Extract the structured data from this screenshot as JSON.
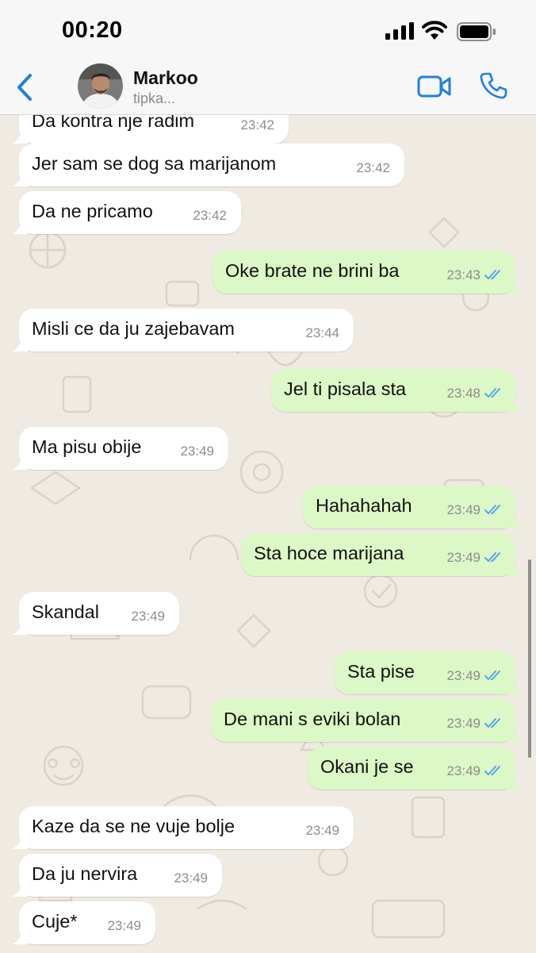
{
  "status_bar": {
    "time": "00:20"
  },
  "header": {
    "contact_name": "Markoo",
    "contact_status": "tipka..."
  },
  "messages": [
    {
      "text": "Da kontra nje radim",
      "time": "23:42",
      "dir": "in"
    },
    {
      "text": "Jer sam se dog sa marijanom",
      "time": "23:42",
      "dir": "in"
    },
    {
      "text": "Da ne pricamo",
      "time": "23:42",
      "dir": "in"
    },
    {
      "text": "Oke brate ne brini ba",
      "time": "23:43",
      "dir": "out"
    },
    {
      "text": "Misli ce da ju zajebavam",
      "time": "23:44",
      "dir": "in"
    },
    {
      "text": "Jel ti pisala sta",
      "time": "23:48",
      "dir": "out"
    },
    {
      "text": "Ma pisu obije",
      "time": "23:49",
      "dir": "in"
    },
    {
      "text": "Hahahahah",
      "time": "23:49",
      "dir": "out"
    },
    {
      "text": "Sta hoce marijana",
      "time": "23:49",
      "dir": "out"
    },
    {
      "text": "Skandal",
      "time": "23:49",
      "dir": "in"
    },
    {
      "text": "Sta pise",
      "time": "23:49",
      "dir": "out"
    },
    {
      "text": "De mani s eviki bolan",
      "time": "23:49",
      "dir": "out"
    },
    {
      "text": "Okani je se",
      "time": "23:49",
      "dir": "out"
    },
    {
      "text": "Kaze da se ne vuje bolje",
      "time": "23:49",
      "dir": "in"
    },
    {
      "text": "Da ju nervira",
      "time": "23:49",
      "dir": "in"
    },
    {
      "text": "Cuje*",
      "time": "23:49",
      "dir": "in"
    }
  ],
  "colors": {
    "accent": "#1f7fe0",
    "incoming_bubble": "#ffffff",
    "outgoing_bubble": "#dcf8c6",
    "read_ticks": "#53a6e8",
    "chat_background": "#efeae2"
  },
  "icons": {
    "back": "chevron-left-icon",
    "video": "video-camera-icon",
    "call": "phone-icon",
    "read": "double-check-icon"
  }
}
